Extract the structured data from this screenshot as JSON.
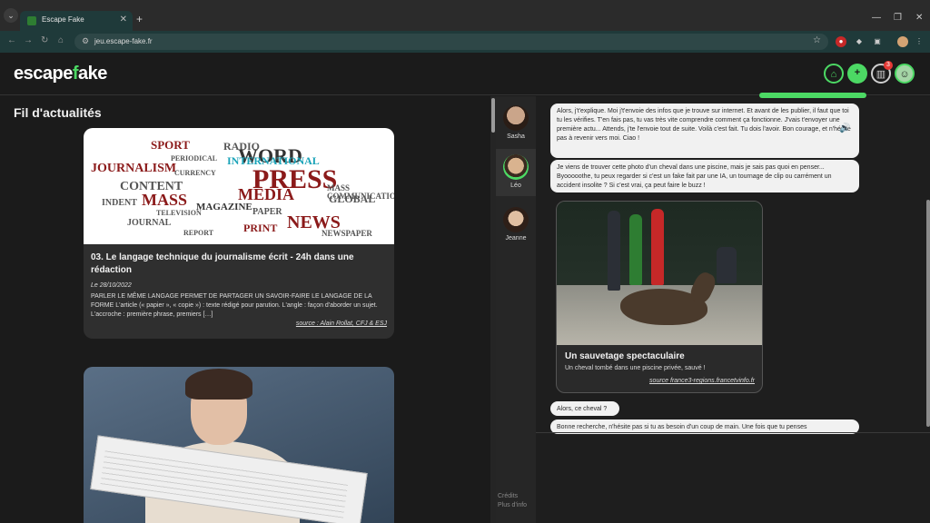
{
  "browser": {
    "tab_title": "Escape Fake",
    "tab_close": "✕",
    "new_tab": "+",
    "url": "jeu.escape-fake.fr",
    "win_min": "—",
    "win_max": "❐",
    "win_close": "✕",
    "icons": {
      "tab_menu": "chevron-down-icon",
      "back": "back-arrow-icon",
      "forward": "forward-arrow-icon",
      "reload": "reload-icon",
      "home": "home-icon",
      "site_info": "site-info-icon",
      "bookmark": "star-icon",
      "menu": "kebab-menu-icon"
    }
  },
  "app": {
    "logo_main": "escape",
    "logo_accent": "f",
    "logo_rest": "ake",
    "notification_count": "3",
    "colors": {
      "accent": "#4cd964",
      "badge": "#e53935",
      "background": "#1b1b1b"
    }
  },
  "feed": {
    "title": "Fil d'actualités",
    "articles": [
      {
        "image_words": [
          "SPORT",
          "PRESS",
          "WORD",
          "JOURNALISM",
          "INTERNATIONAL",
          "CONTENT",
          "MASS",
          "MEDIA",
          "PRINT",
          "NEWS",
          "MAGAZINE",
          "INDENT",
          "PAPER",
          "PERIODICAL",
          "CURRENCY",
          "GLOBAL",
          "TELEVISION",
          "JOURNAL",
          "REPORT",
          "MASS COMMUNICATION",
          "NEWSPAPER",
          "RADIO"
        ],
        "title": "03. Le langage technique du journalisme écrit - 24h dans une rédaction",
        "date": "Le 28/10/2022",
        "excerpt": "PARLER LE MÊME LANGAGE PERMET DE PARTAGER UN SAVOIR-FAIRE LE LANGAGE DE LA FORME L'article (« papier », « copie ») : texte rédigé pour parution. L'angle : façon d'aborder un sujet. L'accroche : première phrase, premiers […]",
        "source": "source : Alain Rollat, CFJ & ESJ"
      }
    ]
  },
  "contacts": [
    {
      "name": "Sasha"
    },
    {
      "name": "Léo"
    },
    {
      "name": "Jeanne"
    }
  ],
  "sidebar_links": {
    "credits": "Crédits",
    "more_info": "Plus d'info"
  },
  "chat": {
    "messages": [
      "Alors, j't'explique. Moi j't'envoie des infos que je trouve sur internet. Et avant de les publier, il faut que toi tu les vérifies. T'en fais pas, tu vas très vite comprendre comment ça fonctionne. J'vais t'envoyer une première actu... Attends, j'te l'envoie tout de suite. Voilà c'est fait. Tu dois l'avoir. Bon courage, et n'hésite pas à revenir vers moi. Ciao !",
      "Je viens de trouver cette photo d'un cheval dans une piscine, mais je sais pas quoi en penser... Byooooothe, tu peux regarder si c'est un fake fait par une IA, un tournage de clip ou carrément un accident insolite ? Si c'est vrai, ça peut faire le buzz !",
      "Alors, ce cheval ?",
      "Bonne recherche, n'hésite pas si tu as besoin d'un coup de main. Une fois que tu penses"
    ],
    "media": {
      "title": "Un sauvetage spectaculaire",
      "subtitle": "Un cheval tombé dans une piscine privée, sauvé !",
      "source": "source france3-regions.francetvinfo.fr"
    }
  }
}
